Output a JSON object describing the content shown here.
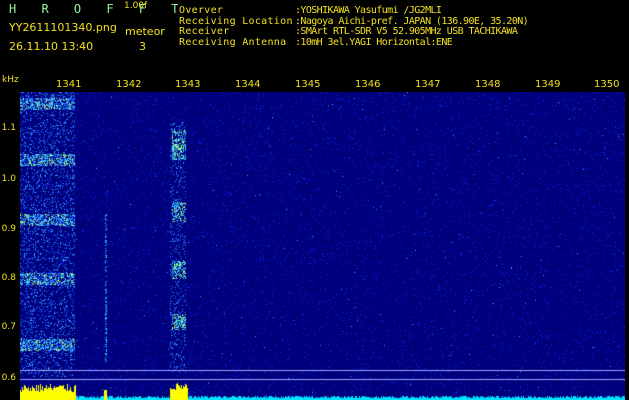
{
  "header": {
    "app_title": "H R O F F T",
    "version": "1.00f",
    "file_name": "YY2611101340.png",
    "mode_label": "meteor",
    "timestamp": "26.11.10 13:40",
    "meteor_count": "3"
  },
  "info": [
    {
      "key": "Overver",
      "value": ":YOSHIKAWA Yasufumi /JG2MLI"
    },
    {
      "key": "Receiving Location",
      "value": ":Nagoya Aichi-pref. JAPAN (136.90E, 35.20N)"
    },
    {
      "key": "Receiver",
      "value": ":SMArt RTL-SDR V5 52.905MHz USB TACHIKAWA"
    },
    {
      "key": "Receiving Antenna",
      "value": ":10mH 3el.YAGI Horizontal:ENE"
    }
  ],
  "axis": {
    "unit_label": "kHz",
    "time_ticks": [
      "1341",
      "1342",
      "1343",
      "1344",
      "1345",
      "1346",
      "1347",
      "1348",
      "1349",
      "1350"
    ],
    "freq_ticks": [
      "1.1",
      "1.0",
      "0.9",
      "0.8",
      "0.7",
      "0.6"
    ]
  },
  "colors": {
    "background": "#000000",
    "spectrogram_base": "#00007a",
    "text": "#f2e020",
    "title": "#8ff0a0",
    "gridline": "#9aa3ff",
    "level_bar_signal": "#ffff00",
    "level_bar_noise": "#00e5ff"
  }
}
